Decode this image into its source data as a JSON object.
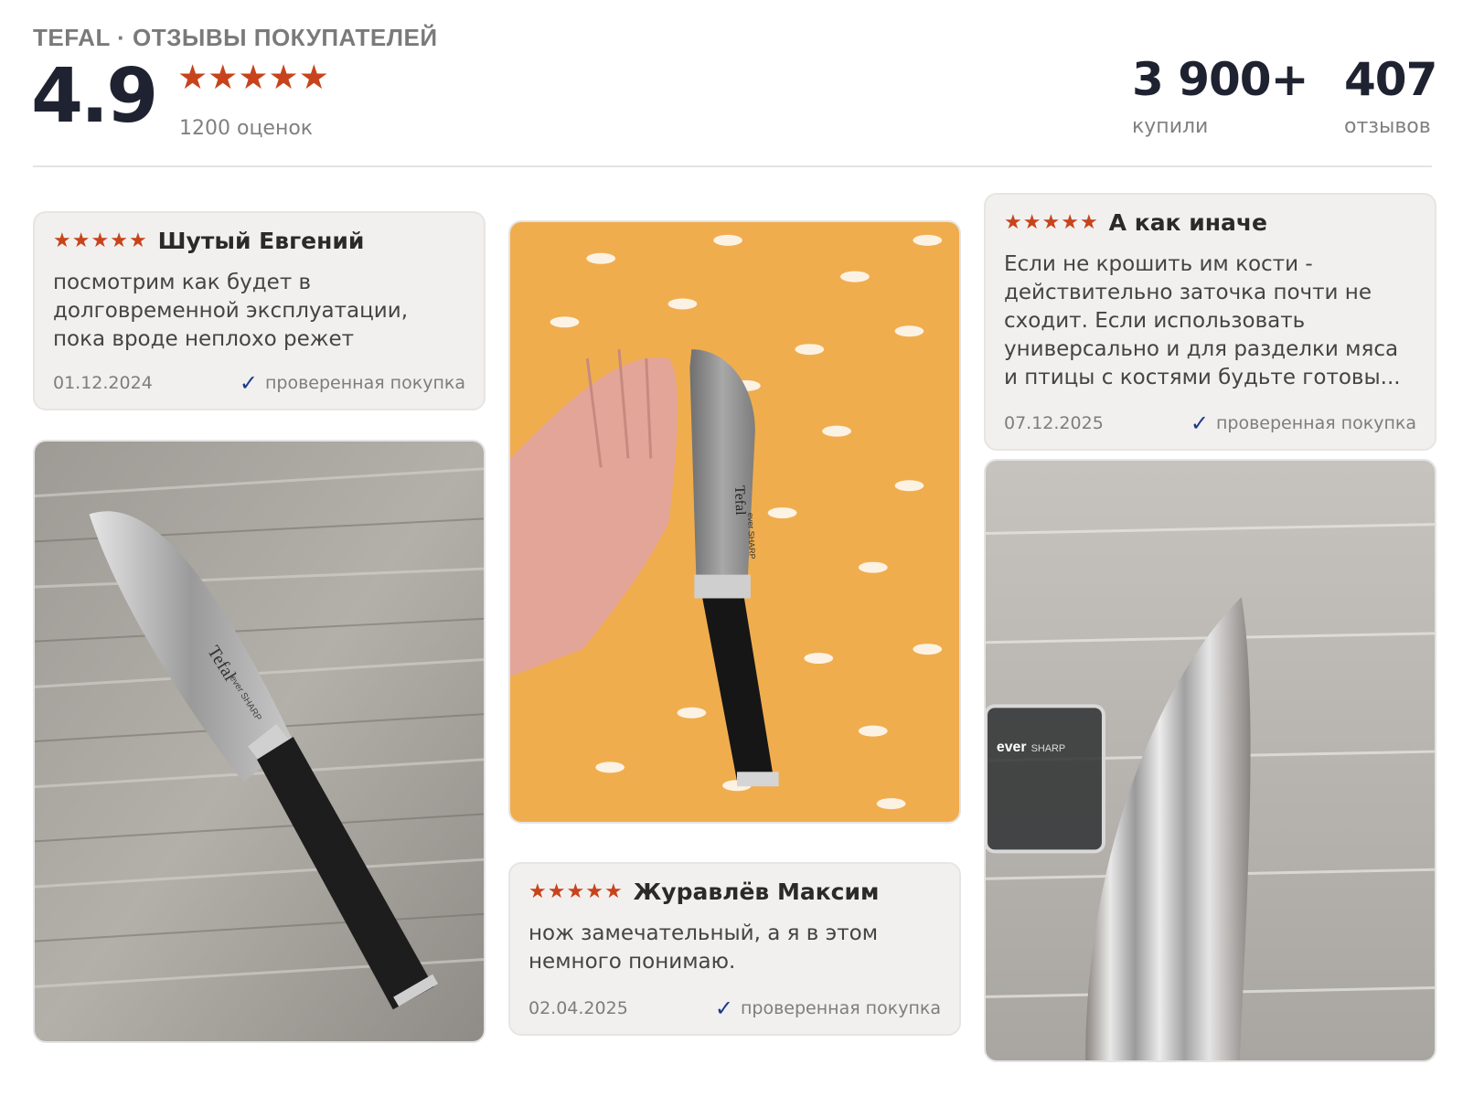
{
  "header": {
    "brand": "TEFAL · ОТЗЫВЫ ПОКУПАТЕЛЕЙ",
    "rating": "4.9",
    "stars": 5,
    "ratings_count": "1200 оценок",
    "bought_value": "3 900+",
    "bought_label": "купили",
    "reviews_value": "407",
    "reviews_label": "отзывов"
  },
  "reviews": [
    {
      "stars": 5,
      "author": "Шутый Евгений",
      "text": "посмотрим как будет в долговременной эксплуатации, пока вроде неплохо режет",
      "date": "01.12.2024",
      "verified": "проверенная покупка"
    },
    {
      "stars": 5,
      "author": "Журавлёв Максим",
      "text": "нож замечательный, а я в этом немного понимаю.",
      "date": "02.04.2025",
      "verified": "проверенная покупка"
    },
    {
      "stars": 5,
      "author": "А как иначе",
      "text": "Если не крошить им кости - действительно заточка почти не сходит. Если использовать универсально и для разделки мяса и птицы с костями будьте готовы...",
      "date": "07.12.2025",
      "verified": "проверенная покупка"
    }
  ],
  "photos": [
    {
      "logo": "Tefal",
      "sub": "ever SHARP",
      "background_color": "#a9a6a1"
    },
    {
      "logo": "Tefal",
      "sub": "ever SHARP",
      "background_color": "#f0ad4e"
    },
    {
      "logo": "ever",
      "sub": "SHARP",
      "background_color": "#bdbab5"
    }
  ],
  "colors": {
    "star": "#c8431b",
    "verified_check": "#1b3a8a",
    "card_bg": "#f1f0ee",
    "title_text": "#1f2230"
  },
  "icons": {
    "star": "star-icon",
    "verified": "check-icon"
  }
}
